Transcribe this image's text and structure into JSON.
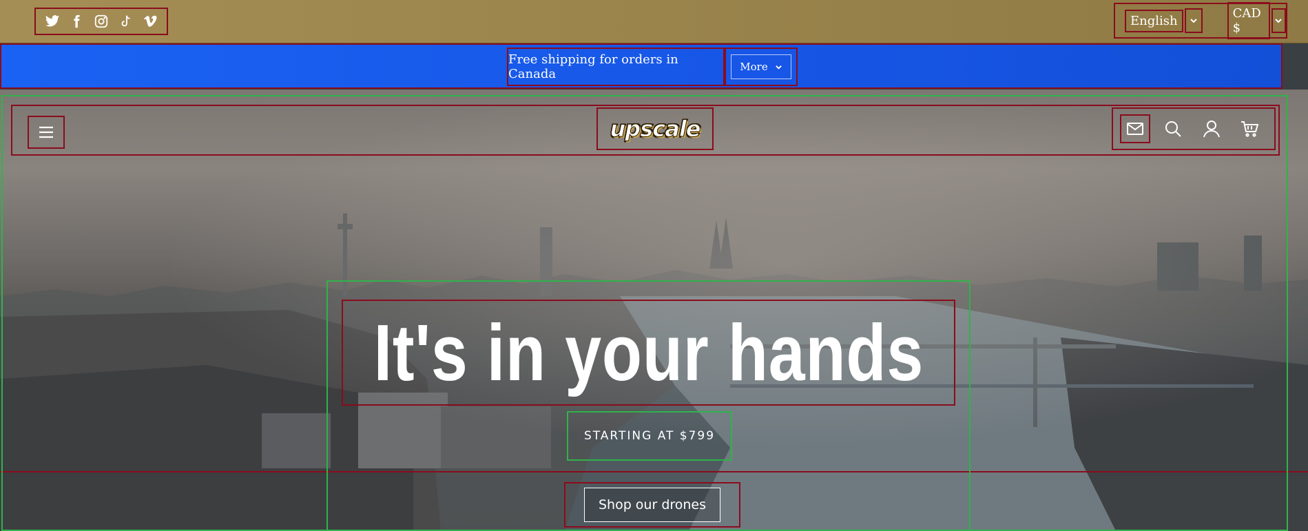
{
  "topbar": {
    "social": [
      {
        "name": "twitter-icon"
      },
      {
        "name": "facebook-icon"
      },
      {
        "name": "instagram-icon"
      },
      {
        "name": "tiktok-icon"
      },
      {
        "name": "vimeo-icon"
      }
    ],
    "language": "English",
    "currency": "CAD $"
  },
  "announcement": {
    "message": "Free shipping for orders in Canada",
    "more_label": "More"
  },
  "header": {
    "logo_text": "upscale",
    "icons": [
      "mail-icon",
      "search-icon",
      "account-icon",
      "cart-icon"
    ]
  },
  "hero": {
    "headline": "It's in your hands",
    "subheading": "STARTING AT $799",
    "cta_label": "Shop our drones"
  },
  "colors": {
    "topbar_bg": "#9a844c",
    "announcement_bg": "#1a62f3",
    "text": "#ffffff"
  }
}
